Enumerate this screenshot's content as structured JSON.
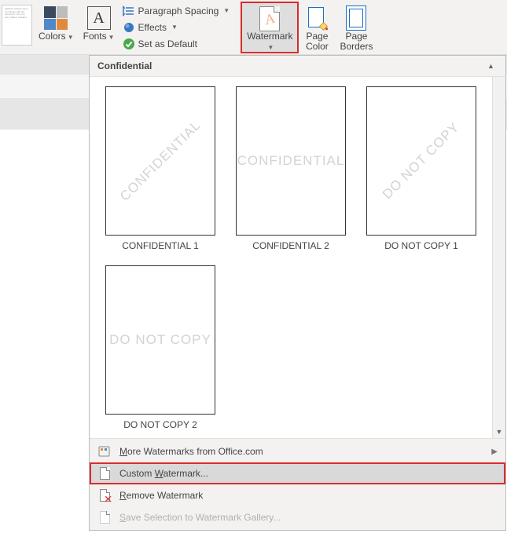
{
  "ribbon": {
    "colors_label": "Colors",
    "fonts_label": "Fonts",
    "paragraph_spacing": "Paragraph Spacing",
    "effects": "Effects",
    "set_default": "Set as Default",
    "watermark_label": "Watermark",
    "page_color_label": "Page\nColor",
    "page_borders_label": "Page\nBorders",
    "snippet_text": "galleries include items coordinate with the document. You can use t tables, headers,"
  },
  "dropdown": {
    "section_title": "Confidential",
    "tiles": [
      {
        "watermark": "CONFIDENTIAL",
        "caption": "CONFIDENTIAL 1",
        "diagonal": true
      },
      {
        "watermark": "CONFIDENTIAL",
        "caption": "CONFIDENTIAL 2",
        "diagonal": false
      },
      {
        "watermark": "DO NOT COPY",
        "caption": "DO NOT COPY 1",
        "diagonal": true
      },
      {
        "watermark": "DO NOT COPY",
        "caption": "DO NOT COPY 2",
        "diagonal": false
      }
    ],
    "more": "More Watermarks from Office.com",
    "custom": "Custom Watermark...",
    "remove": "Remove Watermark",
    "save": "Save Selection to Watermark Gallery..."
  },
  "colors": {
    "c1": "#3b4a61",
    "c2": "#bcbcbc",
    "c3": "#5187c6",
    "c4": "#e08b3c"
  }
}
